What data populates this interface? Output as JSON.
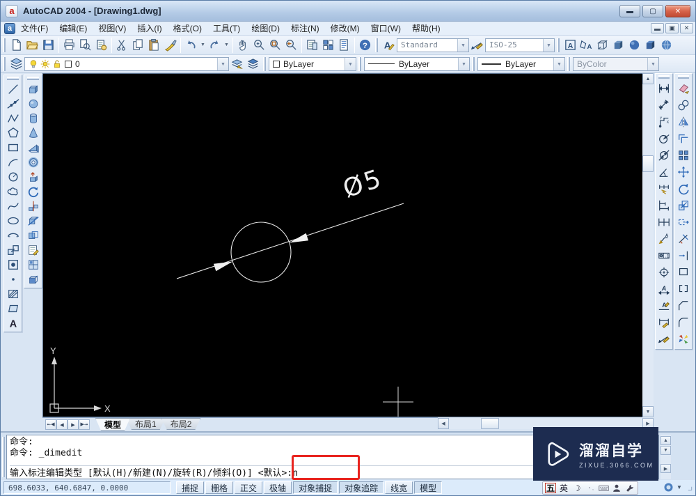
{
  "window": {
    "title": "AutoCAD 2004 - [Drawing1.dwg]"
  },
  "menu": {
    "items": [
      "文件(F)",
      "编辑(E)",
      "视图(V)",
      "插入(I)",
      "格式(O)",
      "工具(T)",
      "绘图(D)",
      "标注(N)",
      "修改(M)",
      "窗口(W)",
      "帮助(H)"
    ]
  },
  "toolbars": {
    "standard": {
      "buttons": [
        "new",
        "open",
        "save",
        "print",
        "print-preview",
        "plot",
        "cut",
        "copy",
        "paste",
        "match-properties",
        "undo",
        "redo",
        "pan-realtime",
        "zoom-realtime",
        "zoom-window",
        "zoom-previous",
        "properties",
        "design-center",
        "tool-palettes",
        "help"
      ]
    },
    "styles": {
      "text_style": "Standard",
      "dim_style": "ISO-25"
    },
    "shade": {
      "buttons": [
        "text-style-manager",
        "dim-style-manager",
        "3d-wireframe",
        "hidden",
        "flat-shaded",
        "gouraud-shaded",
        "render"
      ]
    },
    "layers": {
      "current_layer": "0",
      "buttons": [
        "layer-properties-manager",
        "layer-states",
        "layer-previous"
      ]
    },
    "properties": {
      "color": "ByLayer",
      "linetype": "ByLayer",
      "lineweight": "ByLayer",
      "plot_style": "ByColor"
    },
    "draw": {
      "buttons": [
        "line",
        "construction-line",
        "polyline",
        "polygon",
        "rectangle",
        "arc",
        "circle",
        "revision-cloud",
        "spline",
        "ellipse",
        "ellipse-arc",
        "insert-block",
        "make-block",
        "point",
        "hatch",
        "region",
        "multiline-text"
      ]
    },
    "solids": {
      "buttons": [
        "box",
        "sphere",
        "cylinder",
        "cone",
        "wedge",
        "torus",
        "extrude",
        "revolve",
        "slice",
        "section",
        "interference",
        "setup-drawing",
        "setup-view",
        "setup-profile"
      ]
    },
    "dimension": {
      "buttons": [
        "linear",
        "aligned",
        "ordinate",
        "radius",
        "diameter",
        "angular",
        "quick-dimension",
        "baseline",
        "continue",
        "quick-leader",
        "tolerance",
        "center-mark",
        "dimension-edit",
        "dimension-text-edit",
        "dimension-update",
        "dimension-style"
      ]
    },
    "modify": {
      "buttons": [
        "erase",
        "copy-object",
        "mirror",
        "offset",
        "array",
        "move",
        "rotate",
        "scale",
        "stretch",
        "trim",
        "extend",
        "break-at-point",
        "break",
        "chamfer",
        "fillet",
        "explode"
      ]
    }
  },
  "canvas": {
    "dimension_text": "Ø5",
    "ucs": {
      "x_label": "X",
      "y_label": "Y"
    }
  },
  "layout_tabs": {
    "tabs": [
      {
        "label": "模型",
        "active": true
      },
      {
        "label": "布局1",
        "active": false
      },
      {
        "label": "布局2",
        "active": false
      }
    ]
  },
  "command": {
    "history": [
      "命令:",
      "命令: _dimedit"
    ],
    "prompt": "输入标注编辑类型 [默认(H)/新建(N)/旋转(R)/倾斜(O)] ",
    "highlighted_input": "<默认>:n"
  },
  "status": {
    "coordinates": "698.6033, 640.6847, 0.0000",
    "toggles": [
      {
        "label": "捕捉",
        "active": false
      },
      {
        "label": "栅格",
        "active": false
      },
      {
        "label": "正交",
        "active": false
      },
      {
        "label": "极轴",
        "active": false
      },
      {
        "label": "对象捕捉",
        "active": true
      },
      {
        "label": "对象追踪",
        "active": true
      },
      {
        "label": "线宽",
        "active": false
      },
      {
        "label": "模型",
        "active": true
      }
    ]
  },
  "ime": {
    "items": [
      "五",
      "英"
    ]
  },
  "watermark": {
    "brand": "溜溜自学",
    "site": "ZIXUE.3066.COM"
  },
  "colors": {
    "canvas_bg": "#000000",
    "highlight_box": "#e8241f",
    "watermark_bg": "#1d2c50",
    "drawing": "#f0f0f0"
  }
}
